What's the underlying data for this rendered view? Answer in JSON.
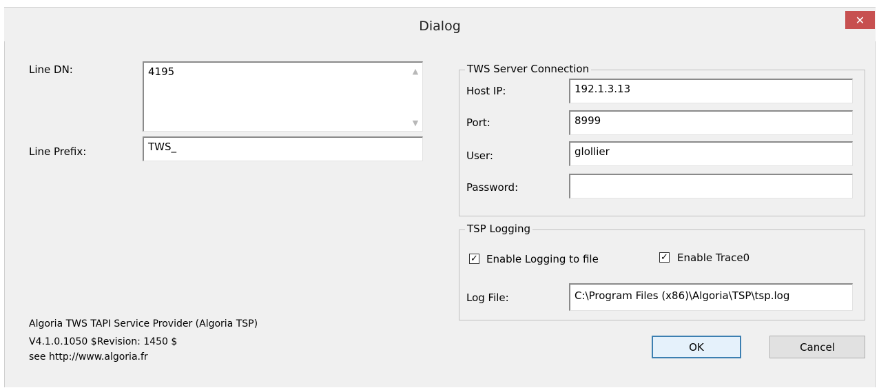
{
  "window": {
    "title": "Dialog",
    "close_icon": "✕"
  },
  "left": {
    "line_dn_label": "Line DN:",
    "line_dn_value": "4195",
    "line_prefix_label": "Line Prefix:",
    "line_prefix_value": "TWS_"
  },
  "server": {
    "group_title": "TWS Server Connection",
    "host_label": "Host IP:",
    "host_value": "192.1.3.13",
    "port_label": "Port:",
    "port_value": "8999",
    "user_label": "User:",
    "user_value": "glollier",
    "password_label": "Password:",
    "password_value": ""
  },
  "logging": {
    "group_title": "TSP Logging",
    "enable_logging_label": "Enable Logging to file",
    "enable_logging_checked": true,
    "enable_trace_label": "Enable Trace0",
    "enable_trace_checked": true,
    "check_mark": "✓",
    "log_file_label": "Log File:",
    "log_file_value": "C:\\Program Files (x86)\\Algoria\\TSP\\tsp.log"
  },
  "info": {
    "line1": "Algoria TWS TAPI Service Provider (Algoria TSP)",
    "line2": "V4.1.0.1050 $Revision: 1450 $",
    "line3": "see http://www.algoria.fr"
  },
  "buttons": {
    "ok": "OK",
    "cancel": "Cancel"
  }
}
